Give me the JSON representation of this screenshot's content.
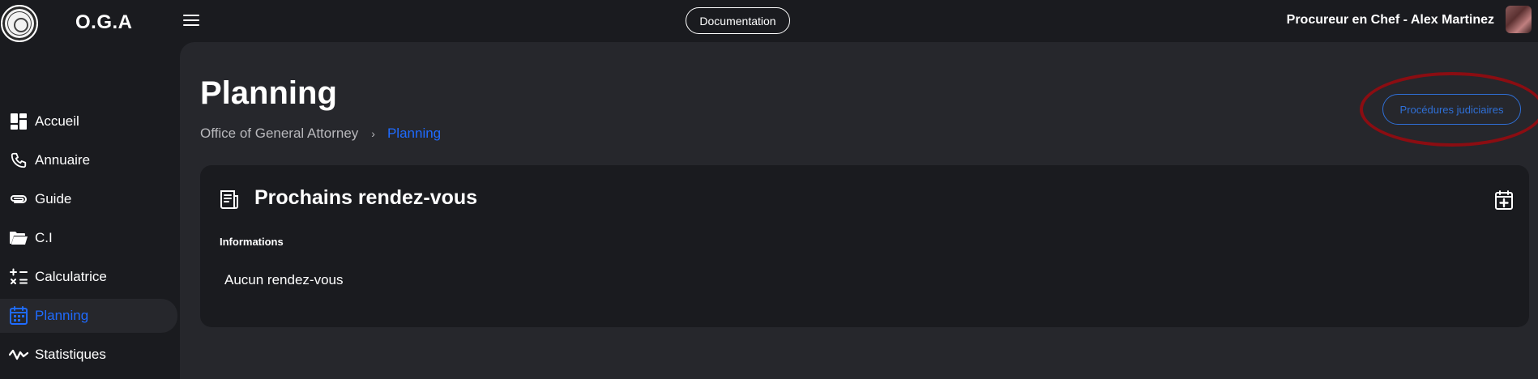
{
  "header": {
    "brand": "O.G.A",
    "documentation_label": "Documentation",
    "user_name": "Procureur en Chef - Alex Martinez"
  },
  "sidebar": {
    "items": [
      {
        "label": "Accueil",
        "icon": "dashboard-icon",
        "active": false
      },
      {
        "label": "Annuaire",
        "icon": "phone-icon",
        "active": false
      },
      {
        "label": "Guide",
        "icon": "paperclip-icon",
        "active": false
      },
      {
        "label": "C.I",
        "icon": "folder-open-icon",
        "active": false
      },
      {
        "label": "Calculatrice",
        "icon": "calculator-icon",
        "active": false
      },
      {
        "label": "Planning",
        "icon": "calendar-icon",
        "active": true
      },
      {
        "label": "Statistiques",
        "icon": "activity-icon",
        "active": false
      }
    ]
  },
  "main": {
    "title": "Planning",
    "breadcrumb": {
      "root": "Office of General Attorney",
      "separator": "›",
      "current": "Planning"
    },
    "procedures_button": "Procédures judiciaires",
    "card": {
      "title": "Prochains rendez-vous",
      "info_label": "Informations",
      "empty_text": "Aucun rendez-vous"
    }
  },
  "colors": {
    "accent": "#1f6bff",
    "annotation_red": "#8b0d12",
    "background": "#1a1b1f",
    "panel": "#26272c"
  }
}
